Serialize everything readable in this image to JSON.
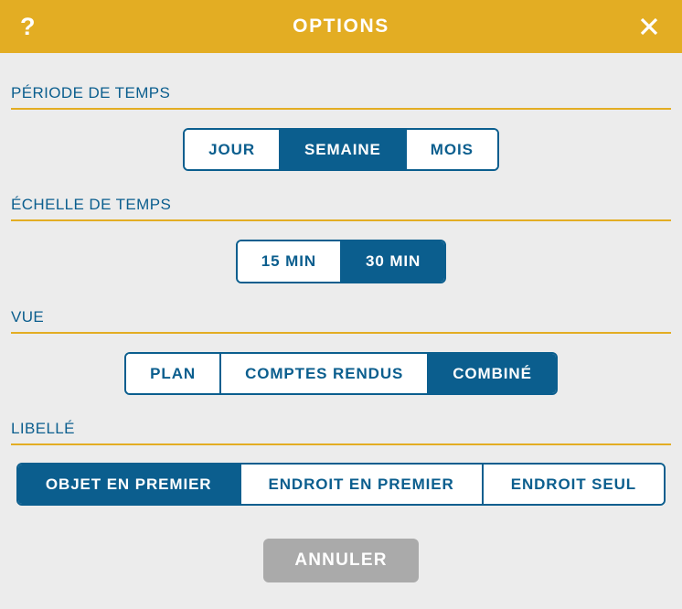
{
  "dialog": {
    "titlebar": {
      "help_icon": "?",
      "title": "OPTIONS",
      "close_icon": "close-icon"
    },
    "accent_colors": {
      "titlebar_gold": "#e3ad23",
      "rule_gold": "#e3ad23",
      "primary_blue": "#0b5e8e",
      "background_gray": "#ececec",
      "disabled_gray": "#aaaaaa",
      "white": "#ffffff"
    },
    "sections": [
      {
        "key": "periode_de_temps",
        "label": "PÉRIODE DE TEMPS",
        "options": [
          {
            "label": "JOUR",
            "selected": false
          },
          {
            "label": "SEMAINE",
            "selected": true
          },
          {
            "label": "MOIS",
            "selected": false
          }
        ]
      },
      {
        "key": "echelle_de_temps",
        "label": "ÉCHELLE DE TEMPS",
        "options": [
          {
            "label": "15 MIN",
            "selected": false
          },
          {
            "label": "30 MIN",
            "selected": true
          }
        ]
      },
      {
        "key": "vue",
        "label": "VUE",
        "options": [
          {
            "label": "PLAN",
            "selected": false
          },
          {
            "label": "COMPTES RENDUS",
            "selected": false
          },
          {
            "label": "COMBINÉ",
            "selected": true
          }
        ]
      },
      {
        "key": "libelle",
        "label": "LIBELLÉ",
        "options": [
          {
            "label": "OBJET EN PREMIER",
            "selected": true
          },
          {
            "label": "ENDROIT EN PREMIER",
            "selected": false
          },
          {
            "label": "ENDROIT SEUL",
            "selected": false
          }
        ]
      }
    ],
    "footer": {
      "cancel_label": "ANNULER"
    }
  }
}
